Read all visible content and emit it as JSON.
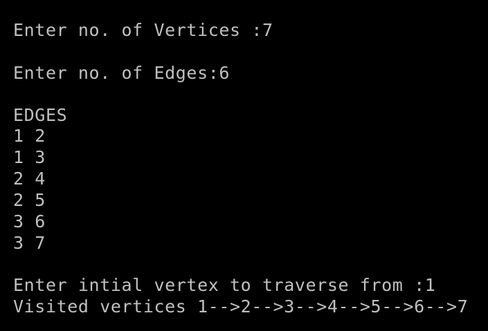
{
  "console": {
    "text_color": "#c0c0c0",
    "background_color": "#000000",
    "lines": [
      "Enter no. of Vertices :7",
      "Enter no. of Edges:6",
      "EDGES",
      "1 2",
      "1 3",
      "2 4",
      "2 5",
      "3 6",
      "3 7",
      "Enter intial vertex to traverse from :1",
      "Visited vertices 1-->2-->3-->4-->5-->6-->7"
    ]
  }
}
